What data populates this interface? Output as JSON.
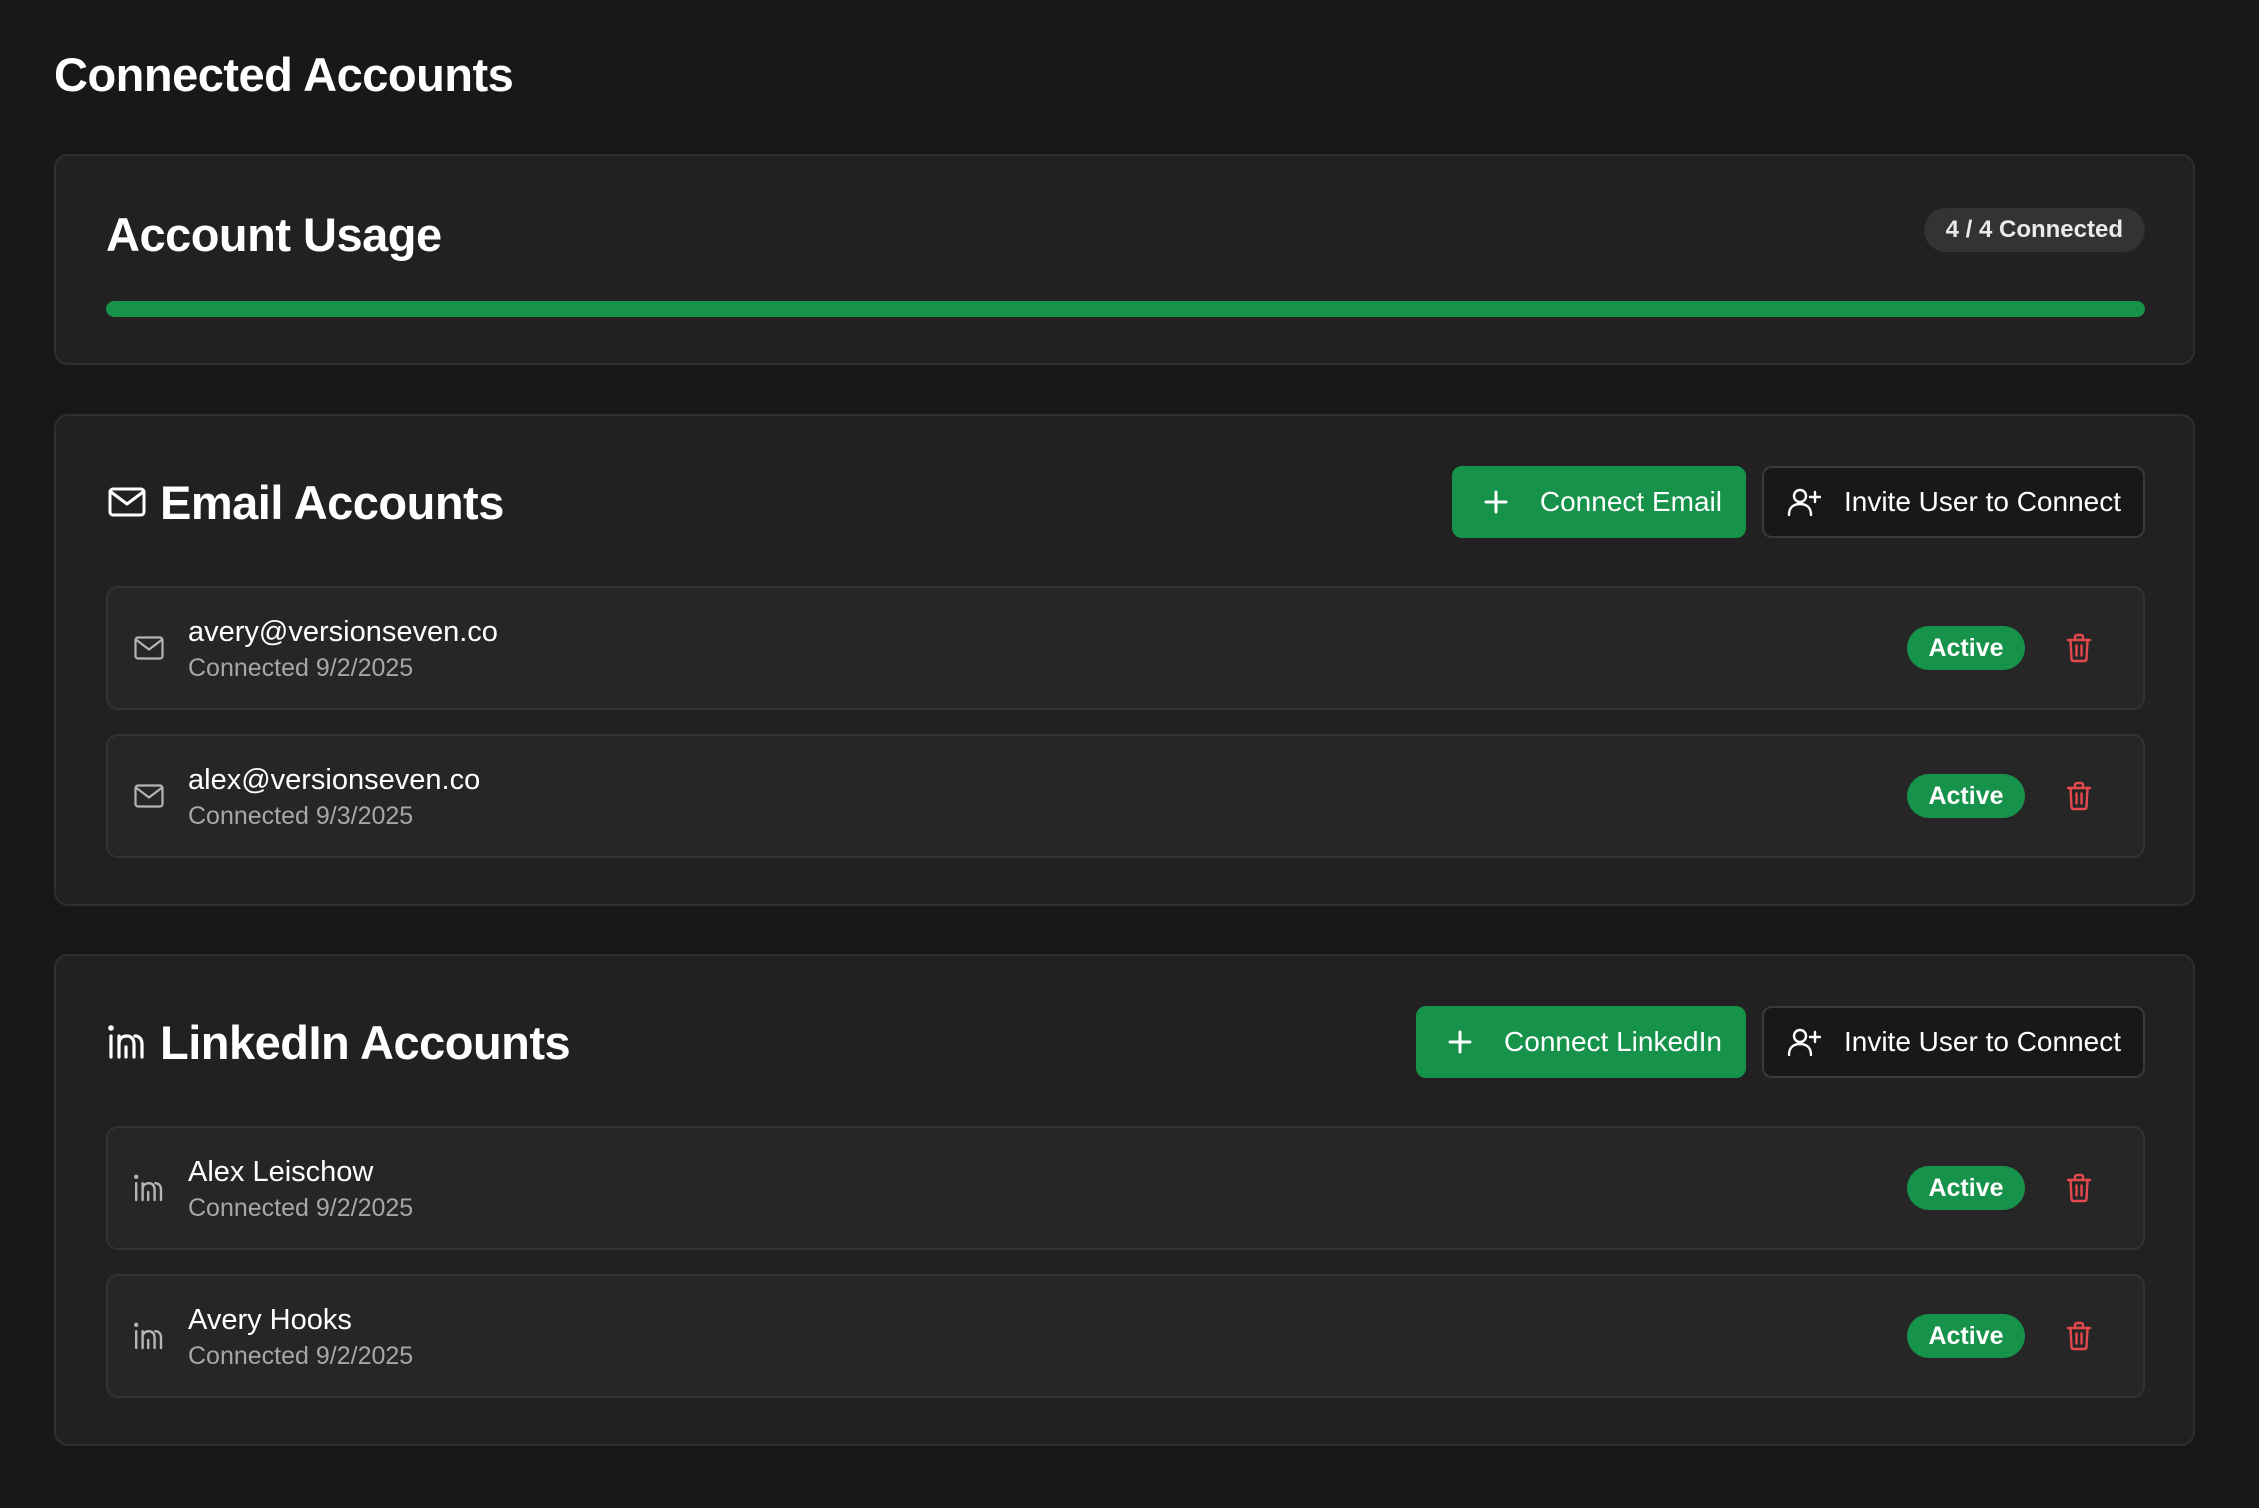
{
  "page": {
    "title": "Connected Accounts"
  },
  "usage": {
    "title": "Account Usage",
    "badge": "4 / 4 Connected",
    "progress_fraction": 1.0
  },
  "email": {
    "title": "Email Accounts",
    "icon": "mail-icon",
    "connect_label": "Connect Email",
    "invite_label": "Invite User to Connect",
    "accounts": [
      {
        "name": "avery@versionseven.co",
        "connected": "Connected 9/2/2025",
        "status": "Active"
      },
      {
        "name": "alex@versionseven.co",
        "connected": "Connected 9/3/2025",
        "status": "Active"
      }
    ]
  },
  "linkedin": {
    "title": "LinkedIn Accounts",
    "icon": "linkedin-icon",
    "connect_label": "Connect LinkedIn",
    "invite_label": "Invite User to Connect",
    "accounts": [
      {
        "name": "Alex Leischow",
        "connected": "Connected 9/2/2025",
        "status": "Active"
      },
      {
        "name": "Avery Hooks",
        "connected": "Connected 9/2/2025",
        "status": "Active"
      }
    ]
  },
  "colors": {
    "accent": "#16924a",
    "danger": "#e5484d",
    "background": "#181818",
    "card": "#212121"
  }
}
